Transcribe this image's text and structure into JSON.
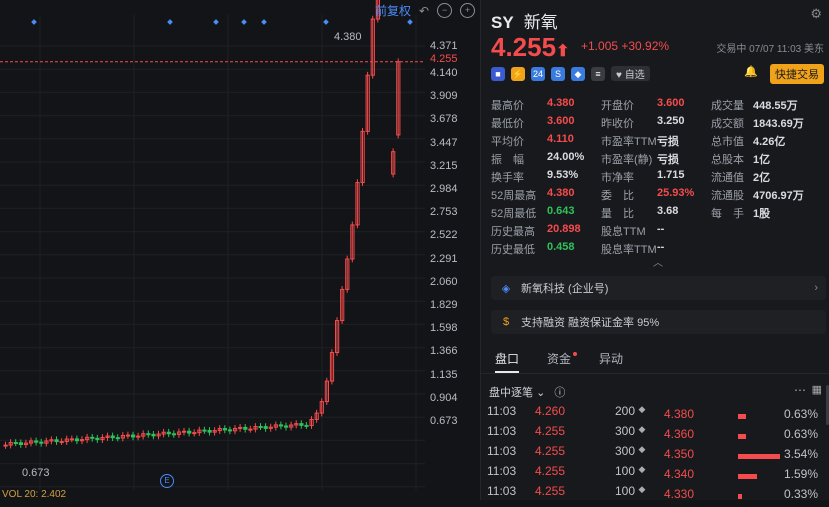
{
  "chart": {
    "top_links": {
      "pre": "前复权",
      "refresh_icon": "undo-icon",
      "sub_icon": "minus-circle-icon",
      "add_icon": "plus-circle-icon"
    },
    "y_ticks": [
      "4.371",
      "4.255",
      "4.140",
      "3.909",
      "3.678",
      "3.447",
      "3.215",
      "2.984",
      "2.753",
      "2.522",
      "2.291",
      "2.060",
      "1.829",
      "1.598",
      "1.366",
      "1.135",
      "0.904",
      "0.673"
    ],
    "high_label": "4.380",
    "low_label": "0.673",
    "volume_label": "VOL 20: 2.402",
    "event_marker": "E",
    "last_price_line": 4.255,
    "accent_up": "#f44c4c",
    "accent_down": "#2fc25b"
  },
  "stock": {
    "ticker": "SY",
    "name": "新氧",
    "price": "4.255",
    "change": "+1.005 +30.92%",
    "status": "交易中 07/07 11:03 美东",
    "badges": [
      "24",
      "S",
      "T"
    ],
    "favorite": "自选",
    "quick_trade": "快捷交易"
  },
  "stats": [
    [
      [
        "最高价",
        "4.380",
        "red"
      ],
      [
        "开盘价",
        "3.600",
        "red"
      ],
      [
        "成交量",
        "448.55万",
        ""
      ]
    ],
    [
      [
        "最低价",
        "3.600",
        "red"
      ],
      [
        "昨收价",
        "3.250",
        ""
      ],
      [
        "成交额",
        "1843.69万",
        ""
      ]
    ],
    [
      [
        "平均价",
        "4.110",
        "red"
      ],
      [
        "市盈率TTM",
        "亏损",
        ""
      ],
      [
        "总市值",
        "4.26亿",
        ""
      ]
    ],
    [
      [
        "振　幅",
        "24.00%",
        ""
      ],
      [
        "市盈率(静)",
        "亏损",
        ""
      ],
      [
        "总股本",
        "1亿",
        ""
      ]
    ],
    [
      [
        "换手率",
        "9.53%",
        ""
      ],
      [
        "市净率",
        "1.715",
        ""
      ],
      [
        "流通值",
        "2亿",
        ""
      ]
    ],
    [
      [
        "52周最高",
        "4.380",
        "red"
      ],
      [
        "委　比",
        "25.93%",
        "red"
      ],
      [
        "流通股",
        "4706.97万",
        ""
      ]
    ],
    [
      [
        "52周最低",
        "0.643",
        "green"
      ],
      [
        "量　比",
        "3.68",
        ""
      ],
      [
        "每　手",
        "1股",
        ""
      ]
    ],
    [
      [
        "历史最高",
        "20.898",
        "red"
      ],
      [
        "股息TTM",
        "--",
        ""
      ],
      [
        "",
        "",
        ""
      ]
    ],
    [
      [
        "历史最低",
        "0.458",
        "green"
      ],
      [
        "股息率TTM",
        "--",
        ""
      ],
      [
        "",
        "",
        ""
      ]
    ]
  ],
  "cards": {
    "company": "新氧科技 (企业号)",
    "margin": "支持融资 融资保证金率 95%"
  },
  "tabs": [
    "盘口",
    "资金",
    "异动"
  ],
  "ticks_header": "盘中逐笔",
  "ticks": [
    {
      "time": "11:03",
      "price": "4.260",
      "qty": "200"
    },
    {
      "time": "11:03",
      "price": "4.255",
      "qty": "300"
    },
    {
      "time": "11:03",
      "price": "4.255",
      "qty": "300"
    },
    {
      "time": "11:03",
      "price": "4.255",
      "qty": "100"
    },
    {
      "time": "11:03",
      "price": "4.255",
      "qty": "100"
    }
  ],
  "distribution": [
    {
      "price": "4.380",
      "pct": "0.63%"
    },
    {
      "price": "4.360",
      "pct": "0.63%"
    },
    {
      "price": "4.350",
      "pct": "3.54%"
    },
    {
      "price": "4.340",
      "pct": "1.59%"
    },
    {
      "price": "4.330",
      "pct": "0.33%"
    }
  ]
}
